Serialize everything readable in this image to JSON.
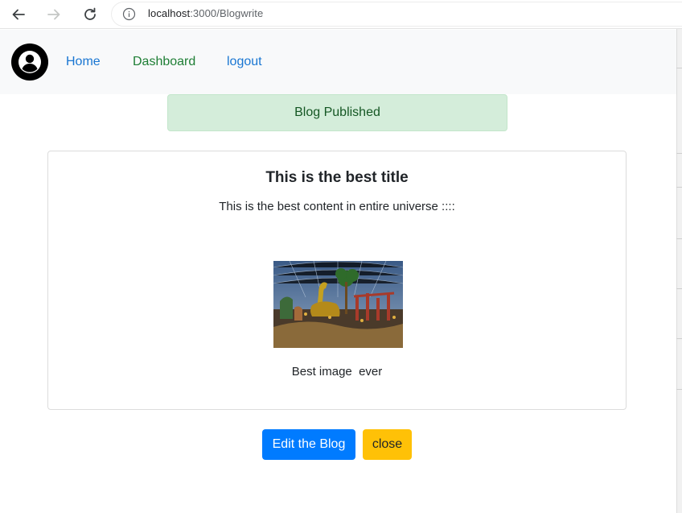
{
  "browser": {
    "url_host": "localhost",
    "url_path": ":3000/Blogwrite"
  },
  "navbar": {
    "items": [
      {
        "label": "Home"
      },
      {
        "label": "Dashboard"
      },
      {
        "label": "logout"
      }
    ]
  },
  "alert": {
    "message": "Blog Published"
  },
  "blog": {
    "title": "This is the best title",
    "content": "This is the best content in entire universe ::::",
    "image_caption": "Best image  ever"
  },
  "actions": {
    "edit_label": "Edit the Blog",
    "close_label": "close"
  },
  "colors": {
    "primary": "#007bff",
    "warning": "#ffc107",
    "success_bg": "#d4edda",
    "link": "#1976d2",
    "dashboard_link": "#1e7e34"
  },
  "icons": [
    "back-arrow-icon",
    "forward-arrow-icon",
    "reload-icon",
    "info-icon",
    "user-avatar-icon"
  ]
}
